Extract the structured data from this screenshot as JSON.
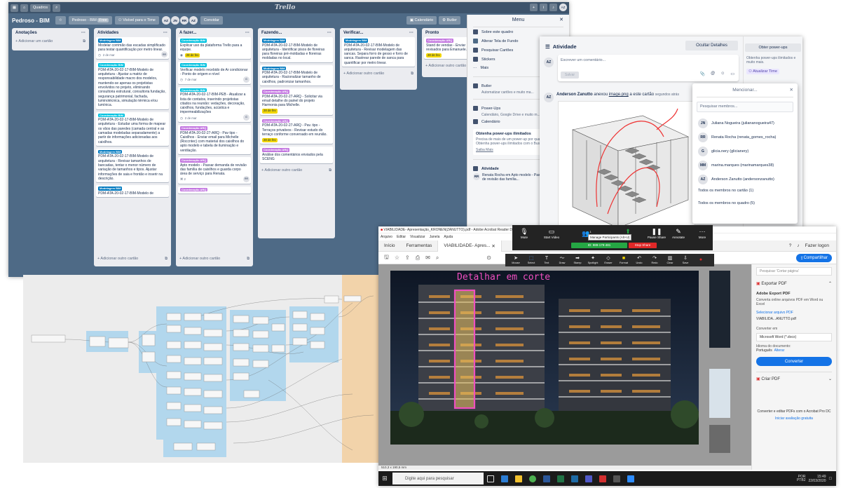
{
  "trello": {
    "topbar": {
      "quadros": "Quadros",
      "logo": "Trello"
    },
    "board": {
      "title": "Pedroso - BIM",
      "team": "Pedroso - BIM",
      "team_badge": "Free",
      "visibility": "Visível para o Time",
      "avatars": [
        "AZ",
        "JN",
        "RR",
        "AZ"
      ],
      "invite": "Convidar",
      "calendar": "Calendário",
      "butler": "Butler"
    },
    "lists": [
      {
        "title": "Anotações",
        "add": "+ Adicionar um cartão",
        "cards": []
      },
      {
        "title": "Atividades",
        "add": "+ Adicionar outro cartão",
        "cards": [
          {
            "label": "Modelagem BIM",
            "color": "#0079bf",
            "text": "Modelar corrimão das escadas simplificado para testar quantificação por metro linear.",
            "date": "2 de mar",
            "avatar": "RR"
          },
          {
            "label": "Coordenação BIM",
            "color": "#00c2e0",
            "text": "PDM-ATA-20-02-17-BIM-Modelo de arquitetura - Ajustar a matriz de responsabilidade macro dos modelos, mantendo-se apenas os projetistas envolvidos no projeto, eliminando consultoria estrutural, consultoria fundação, segurança patrimonial, fachada, luminotécnica, simulação térmica e/ou lumínica.",
            "date": "",
            "avatar": ""
          },
          {
            "label": "Coordenação BIM",
            "color": "#00c2e0",
            "text": "PDM-ATA-20-02-17-BIM-Modelo de arquitetura - Estudar uma forma de mapear os vãos das paredes (camada central e as camadas modeladas separadamente) a partir de informações adicionadas aos caixilhos.",
            "date": "",
            "avatar": ""
          },
          {
            "label": "Modelagem BIM",
            "color": "#0079bf",
            "text": "PDM-ATA-20-02-17-BIM-Modelo de arquitetura - Revisar tamanhos de bancadas, tentar o menor número de variação de tamanhos e tipos. Ajustar informações de saia e frontão e inserir na descrição.",
            "date": "",
            "avatar": ""
          },
          {
            "label": "Modelagem BIM",
            "color": "#0079bf",
            "text": "PDM-ATA-20-02-17-BIM-Modelo de",
            "date": "",
            "avatar": ""
          }
        ]
      },
      {
        "title": "A fazer...",
        "add": "+ Adicionar outro cartão",
        "cards": [
          {
            "label": "Coordenação BIM",
            "color": "#00c2e0",
            "text": "Explicar uso da plataforma Trello para a equipe.",
            "date": "28 de fev",
            "avatar": ""
          },
          {
            "label": "Coordenação BIM",
            "color": "#00c2e0",
            "text": "Verificar modelo recebido de Ar condicionar - Ponto de origem e nível",
            "date": "7 de mar",
            "avatar": ""
          },
          {
            "label": "Coordenação BIM",
            "color": "#00c2e0",
            "text": "PDM-ATA-20-02-17-BIM-PEB - Atualizar a lista de contatos, inserindo projetistas citados na reunião: vedações, decoração, caixilhos, fundações, acústica e impermeabilizações",
            "date": "2 de mar",
            "avatar": ""
          },
          {
            "label": "Coordenação ARQ",
            "color": "#c377e0",
            "text": "PDM-ATA-20-02-27-ARQ - Pav tipo - Caixilhos - Enviar email para Michelle (Roccntec) com material dos caixilhos do apto modelo e tabela de iluminação e ventilação.",
            "date": "",
            "avatar": ""
          },
          {
            "label": "Coordenação ARQ",
            "color": "#c377e0",
            "text": "Apto modelo - Passar demanda de revisão das família de caixilhos e guarda corpo área de serviço para Renata.",
            "date": "",
            "avatar": "RR"
          },
          {
            "label": "Coordenação ARQ",
            "color": "#c377e0",
            "text": "",
            "date": "",
            "avatar": ""
          }
        ]
      },
      {
        "title": "Fazendo...",
        "add": "+ Adicionar outro cartão",
        "cards": [
          {
            "label": "Modelagem BIM",
            "color": "#0079bf",
            "text": "PDM-ATA-20-02-17-BIM-Modelo de arquitetura - Identificar pisos de floreiras para floreiras pré-moldadas e floreiras moldadas no local.",
            "date": "",
            "avatar": ""
          },
          {
            "label": "Modelagem BIM",
            "color": "#0079bf",
            "text": "PDM-ATA-20-02-17-BIM-Modelo de arquitetura - Racionalizar tamanho de caixilhos, padronizar tamanhos.",
            "date": "",
            "avatar": ""
          },
          {
            "label": "Coordenação ARQ",
            "color": "#c377e0",
            "text": "PDM-ATA-20-02-27-ARQ - Solicitar via email detalhe do painel do projeto Harmonia para Michelle.",
            "date": "28 de fev",
            "avatar": ""
          },
          {
            "label": "Coordenação ARQ",
            "color": "#c377e0",
            "text": "PDM-ATA-20-02-27-ARQ - Pav. tipo - Terraços privativos - Revisar estudo do terraço conforme conversado em reunião.",
            "date": "28 de fev",
            "avatar": ""
          },
          {
            "label": "Coordenação ARQ",
            "color": "#c377e0",
            "text": "Análise dos comentários enviados pela SCENG",
            "date": "28 de fev",
            "avatar": ""
          }
        ]
      },
      {
        "title": "Verificar...",
        "add": "+ Adicionar outro cartão",
        "cards": [
          {
            "label": "Modelagem BIM",
            "color": "#0079bf",
            "text": "PDM-ATA-20-02-17-BIM-Modelo de arquitetura - Revisar modelagem das sancas. Separa forro de gesso e forro de sanca. Rastrear parede de sanca para quantificar por metro linear.",
            "date": "",
            "avatar": ""
          }
        ]
      },
      {
        "title": "Pronto",
        "add": "+ Adicionar outro cartão",
        "cards": [
          {
            "label": "Coordenação ARQ",
            "color": "#c377e0",
            "text": "Stand de vendas - Enviar revisados para Emanuele.",
            "date": "28 de fev",
            "avatar": ""
          }
        ]
      }
    ],
    "menu": {
      "title": "Menu",
      "items": [
        "Sobre este quadro",
        "Alterar Tela de Fundo",
        "Pesquisar Cartões",
        "Stickers",
        "Mais"
      ],
      "butler": "Butler",
      "butler_desc": "Automatizar cartões e muito ma...",
      "powerups": "Power-Ups",
      "powerups_desc": "Calendário, Google Drive e muito m...",
      "calendar": "Calendário",
      "promo_title": "Obtenha power-ups ilimitados",
      "promo_text": "Precisa de mais de um power-up por quadro? Obtenha power-ups ilimitados com o Business Cla...",
      "saiba": "Saiba Mais",
      "atividade": "Atividade",
      "activity_user": "Renata Rocha",
      "activity_text": "Renata Rocha em Apto modelo - Passar demanda de revisão das família..."
    }
  },
  "activity": {
    "title": "Atividade",
    "hide_details": "Ocultar Detalhes",
    "comment_placeholder": "Escrever um comentário...",
    "save": "Salvar",
    "user_av": "AZ",
    "entry_user": "Anderson Zanutto",
    "entry_text": "anexou",
    "entry_link": "image.png",
    "entry_suffix": "a este cartão",
    "entry_time": "segundos atrás",
    "get_powerups": "Obter power-ups",
    "powerups_note": "Obtenha power-ups ilimitados e muito mais.",
    "update_team": "Atualizar Time"
  },
  "mention": {
    "title": "Mencionar...",
    "search": "Pesquisar membros...",
    "members": [
      {
        "av": "JN",
        "name": "Juliana Nogueira (juliananogueira47)"
      },
      {
        "av": "RR",
        "name": "Renata Rocha (renata_gomes_rocha)"
      },
      {
        "av": "G",
        "name": "glicia.nery (glicianery)"
      },
      {
        "av": "MM",
        "name": "marina.marques (marinamarques38)"
      },
      {
        "av": "AZ",
        "name": "Anderson Zanutto (andersonzanutto)"
      }
    ],
    "all_card": "Todos os membros no cartão (1)",
    "all_board": "Todos os membros no quadro (5)"
  },
  "acrobat": {
    "title": "VIABILIDADE- Apresentação_KRONEN(ZANUTTO).pdf - Adobe Acrobat Reader DC",
    "menu": [
      "Arquivo",
      "Editar",
      "Visualizar",
      "Janela",
      "Ajuda"
    ],
    "tabs": [
      "Início",
      "Ferramentas",
      "VIABILIDADE- Apres..."
    ],
    "login": "Fazer logon",
    "share": "Compartilhar",
    "annotation": "Detalhar em corte",
    "panel": {
      "search": "Pesquisar 'Cortar página'",
      "export": "Exportar PDF",
      "export_title": "Adobe Export PDF",
      "export_desc": "Converta online arquivos PDF em Word ou Excel",
      "select_file": "Selecionar arquivo PDF",
      "file": "VIABILIDA...ANUTTO.pdf",
      "convert_to": "Converter em",
      "format": "Microsoft Word (*.docx)",
      "lang_label": "Idioma do documento:",
      "lang": "Português",
      "lang_change": "Alterar",
      "convert": "Converter",
      "create": "Criar PDF",
      "promo": "Converter e editar PDFs com o Acrobat Pro DC",
      "trial": "Iniciar avaliação gratuita"
    },
    "status": "510,3 x 190,5 mm",
    "taskbar_search": "Digite aqui para pesquisar",
    "time": "15:49",
    "date": "22/03/2020",
    "lang_tray": "POR PTB2"
  },
  "zoom": {
    "buttons": [
      "Mute",
      "Start Video",
      "Manage Participants",
      "Share",
      "Pause Share",
      "Annotate",
      "More"
    ],
    "participants_count": "1",
    "meeting_id": "ID: 989-179-481",
    "stop": "Stop Share",
    "tooltip": "Manage Participants (Alt+U)"
  },
  "annot_tools": [
    "Mouse",
    "Select",
    "Text",
    "Draw",
    "Stamp",
    "Spotlight",
    "Eraser",
    "Format",
    "Undo",
    "Redo",
    "Clear",
    "Save"
  ]
}
